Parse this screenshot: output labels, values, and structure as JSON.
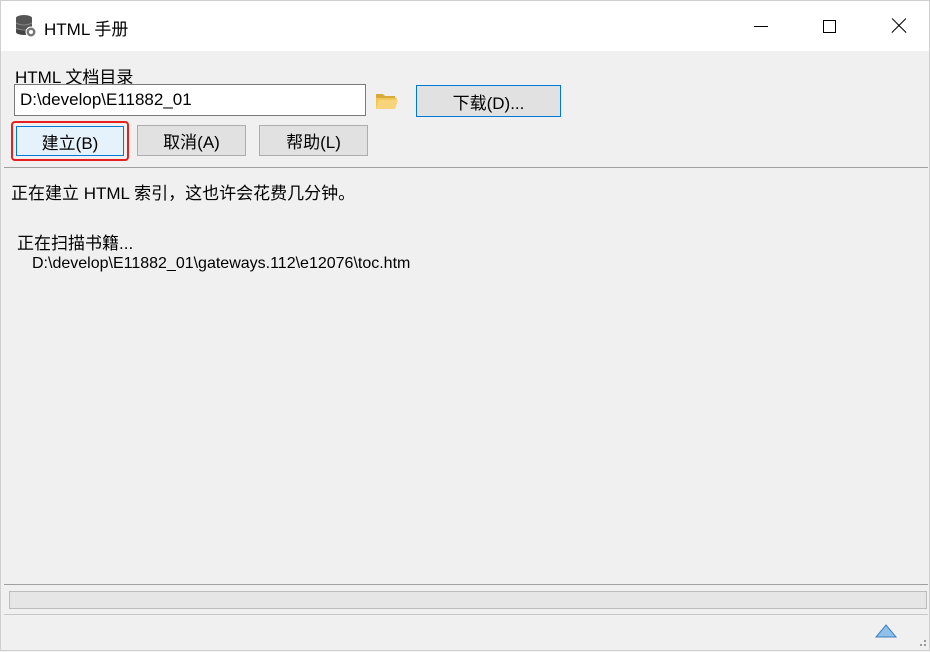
{
  "window": {
    "title": "HTML 手册",
    "app_icon": "database-gear-icon",
    "controls": [
      "minimize-icon",
      "maximize-icon",
      "close-icon"
    ]
  },
  "form": {
    "directory_label": "HTML 文档目录",
    "directory_value": "D:\\develop\\E11882_01",
    "browse_icon": "folder-open-icon",
    "download_button": "下载(D)...",
    "build_button": "建立(B)",
    "cancel_button": "取消(A)",
    "help_button": "帮助(L)"
  },
  "log": {
    "status": "正在建立 HTML 索引，这也许会花费几分钟。",
    "scanning": "正在扫描书籍...",
    "current_file": "D:\\develop\\E11882_01\\gateways.112\\e12076\\toc.htm"
  },
  "progress": {
    "value": 0
  },
  "statusbar": {
    "icon": "expand-up-icon"
  },
  "colors": {
    "highlight": "#e81f1f",
    "focus_border": "#0078d7",
    "window_bg": "#f0f0f0",
    "folder": "#e8b84a"
  }
}
